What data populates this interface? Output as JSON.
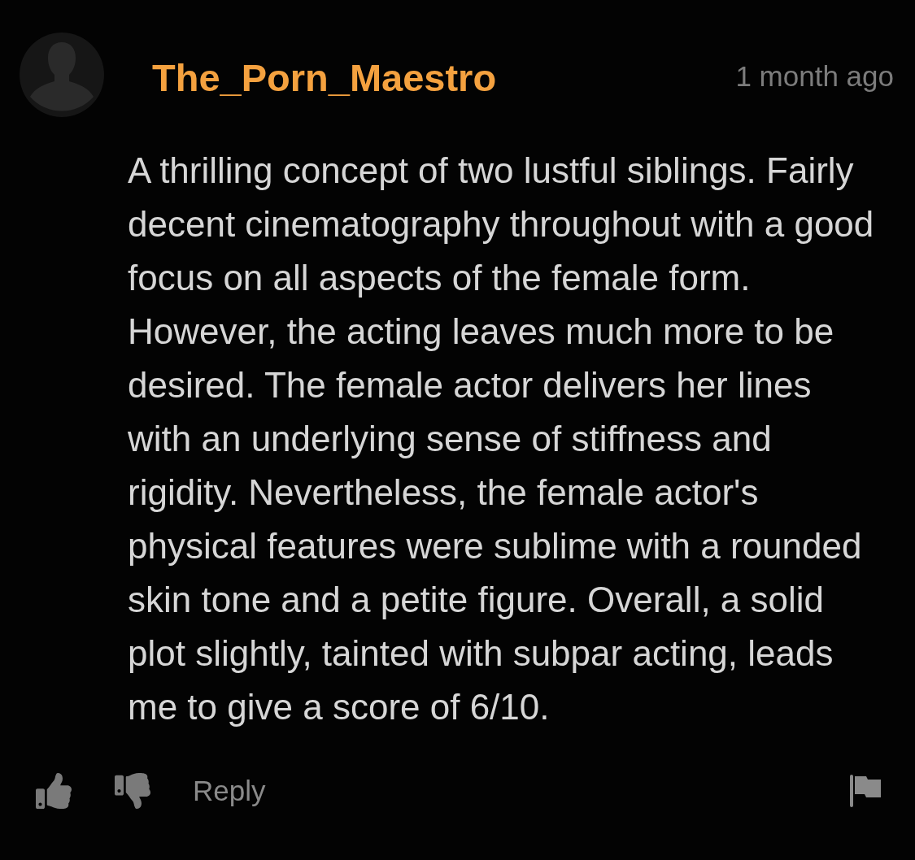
{
  "comment": {
    "username": "The_Porn_Maestro",
    "time": "1 month ago",
    "body": "A thrilling concept of two lustful siblings. Fairly decent cinematography throughout with a good focus on all aspects of the female form. However, the acting leaves much more to be desired. The female actor delivers her lines with an underlying sense of stiffness and rigidity. Nevertheless, the female actor's physical features were sublime with a rounded skin tone and a petite figure. Overall, a solid plot slightly, tainted with subpar acting, leads me to give a score of 6/10.",
    "actions": {
      "reply": "Reply"
    }
  }
}
